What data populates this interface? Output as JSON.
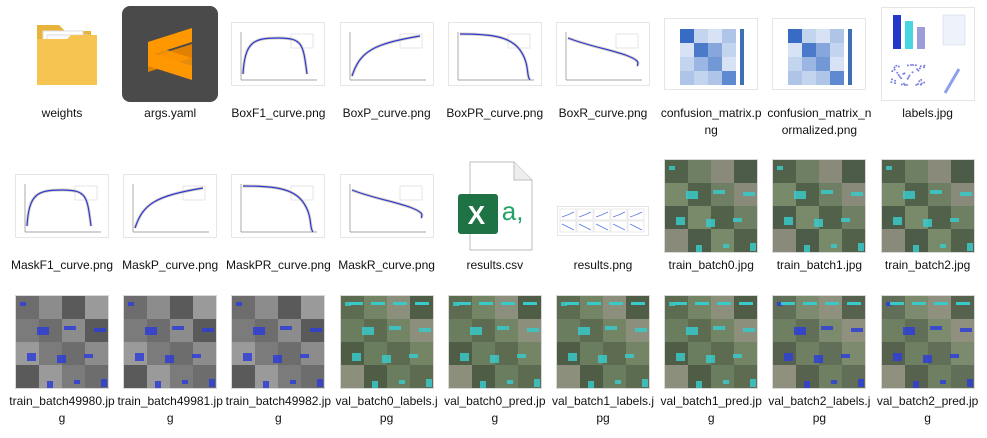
{
  "files": [
    {
      "name": "weights",
      "kind": "folder"
    },
    {
      "name": "args.yaml",
      "kind": "sublime"
    },
    {
      "name": "BoxF1_curve.png",
      "kind": "curve",
      "curve": "f1"
    },
    {
      "name": "BoxP_curve.png",
      "kind": "curve",
      "curve": "p"
    },
    {
      "name": "BoxPR_curve.png",
      "kind": "curve",
      "curve": "pr"
    },
    {
      "name": "BoxR_curve.png",
      "kind": "curve",
      "curve": "r"
    },
    {
      "name": "confusion_matrix.png",
      "kind": "confusion"
    },
    {
      "name": "confusion_matrix_normalized.png",
      "kind": "confusion"
    },
    {
      "name": "labels.jpg",
      "kind": "labels"
    },
    {
      "name": "MaskF1_curve.png",
      "kind": "curve",
      "curve": "f1"
    },
    {
      "name": "MaskP_curve.png",
      "kind": "curve",
      "curve": "p"
    },
    {
      "name": "MaskPR_curve.png",
      "kind": "curve",
      "curve": "pr"
    },
    {
      "name": "MaskR_curve.png",
      "kind": "curve",
      "curve": "r"
    },
    {
      "name": "results.csv",
      "kind": "excel"
    },
    {
      "name": "results.png",
      "kind": "results"
    },
    {
      "name": "train_batch0.jpg",
      "kind": "photo",
      "tone": "teal"
    },
    {
      "name": "train_batch1.jpg",
      "kind": "photo",
      "tone": "teal"
    },
    {
      "name": "train_batch2.jpg",
      "kind": "photo",
      "tone": "teal"
    },
    {
      "name": "train_batch49980.jpg",
      "kind": "photo",
      "tone": "gray"
    },
    {
      "name": "train_batch49981.jpg",
      "kind": "photo",
      "tone": "gray"
    },
    {
      "name": "train_batch49982.jpg",
      "kind": "photo",
      "tone": "gray"
    },
    {
      "name": "val_batch0_labels.jpg",
      "kind": "photo",
      "tone": "val"
    },
    {
      "name": "val_batch0_pred.jpg",
      "kind": "photo",
      "tone": "val"
    },
    {
      "name": "val_batch1_labels.jpg",
      "kind": "photo",
      "tone": "val"
    },
    {
      "name": "val_batch1_pred.jpg",
      "kind": "photo",
      "tone": "val"
    },
    {
      "name": "val_batch2_labels.jpg",
      "kind": "photo",
      "tone": "valblue"
    },
    {
      "name": "val_batch2_pred.jpg",
      "kind": "photo",
      "tone": "valblue"
    }
  ],
  "excel_icon": {
    "letter": "X",
    "accent": "a,"
  },
  "colors": {
    "folder": "#f5c451",
    "sublime_bg": "#4a4a4a",
    "sublime_fg": "#ff9800",
    "excel": "#1f7244",
    "teal": "#39c9c9",
    "blue": "#2f3fd6"
  }
}
